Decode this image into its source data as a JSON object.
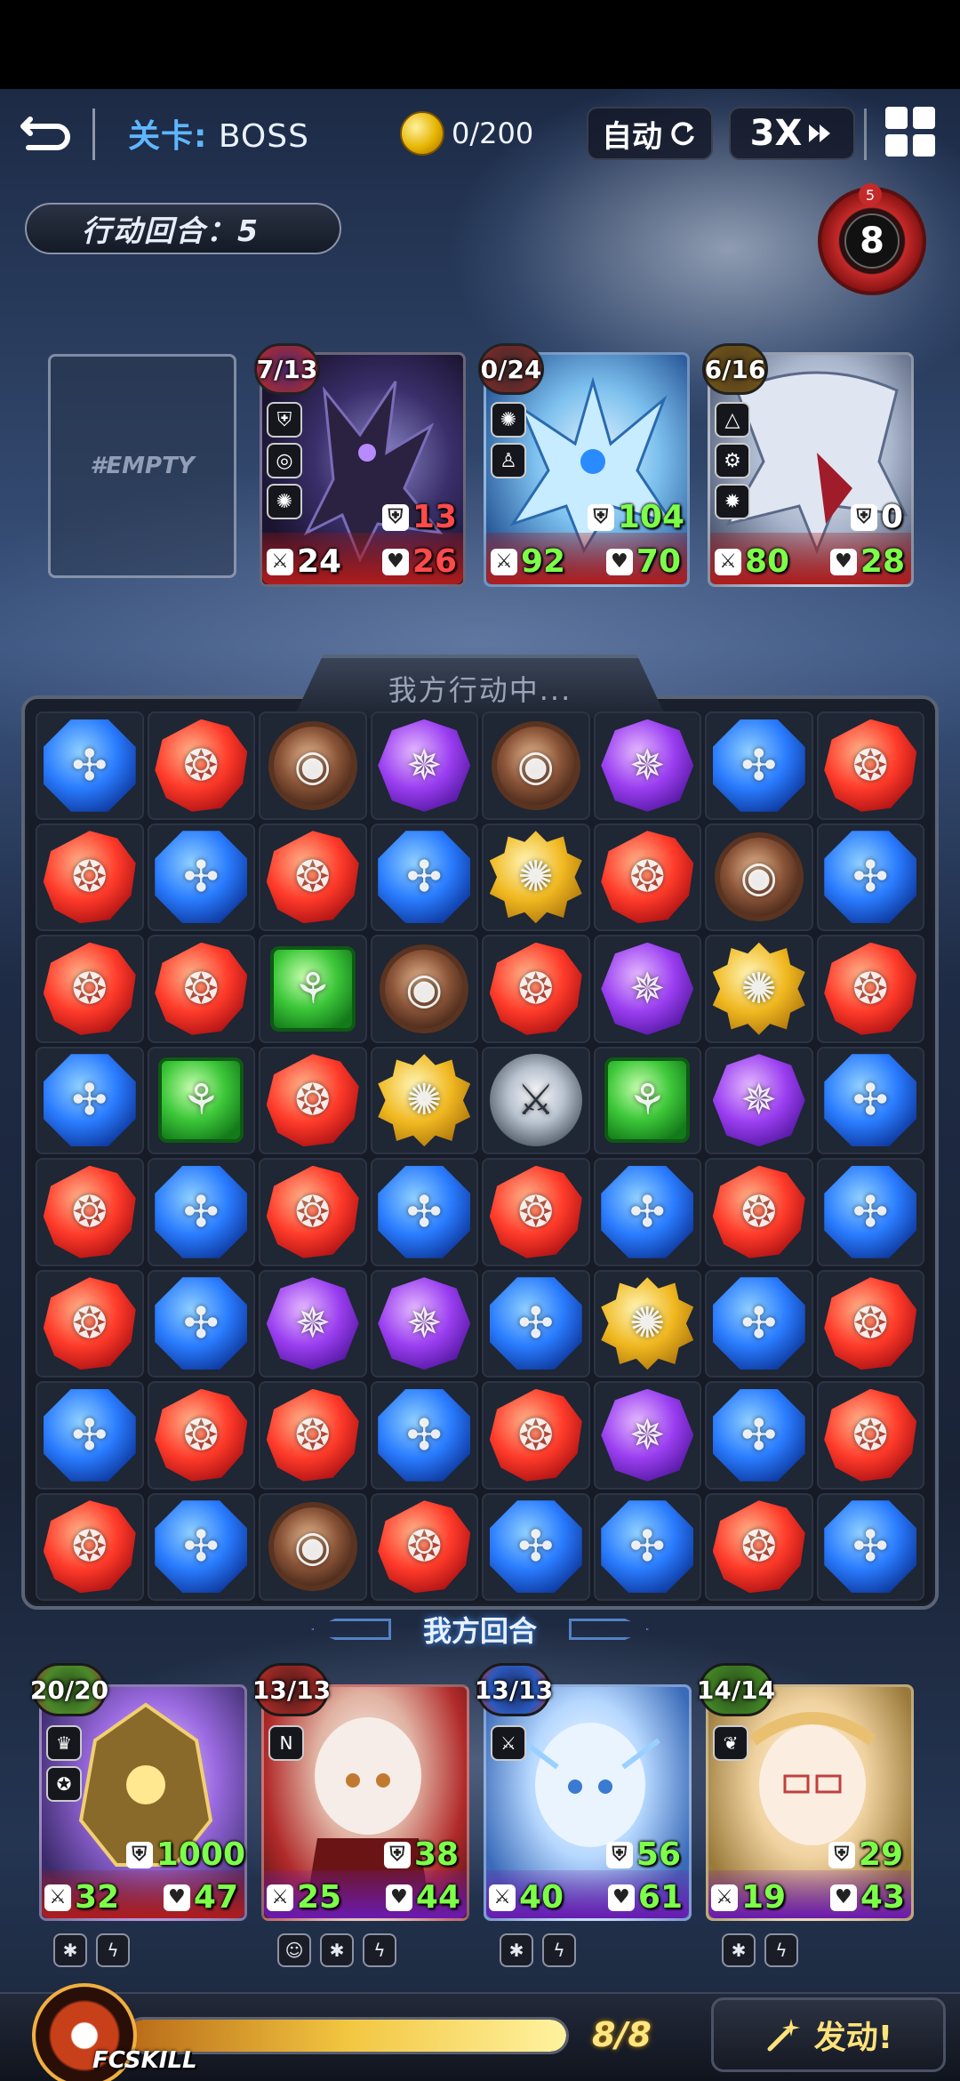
{
  "topbar": {
    "back_icon": "back-arrow-icon",
    "stage_key": "关卡:",
    "stage_value": "BOSS",
    "coin_text": "0/200",
    "auto_label": "自动",
    "speed_label": "3X"
  },
  "turn": {
    "label": "行动回合：5"
  },
  "enemy_timer": {
    "count": "8",
    "tag": "5"
  },
  "enemies": {
    "empty_slot": "#EMPTY",
    "list": [
      {
        "cooldown": "7/13",
        "shield": "13",
        "attack": "24",
        "hp": "26"
      },
      {
        "cooldown": "0/24",
        "shield": "104",
        "attack": "92",
        "hp": "70"
      },
      {
        "cooldown": "6/16",
        "shield": "0",
        "attack": "80",
        "hp": "28"
      }
    ]
  },
  "board": {
    "header": "我方行动中...",
    "footer": "我方回合",
    "rows": [
      [
        "water",
        "fire",
        "earth",
        "dark",
        "earth",
        "dark",
        "water",
        "fire"
      ],
      [
        "fire",
        "water",
        "fire",
        "water",
        "light",
        "fire",
        "earth",
        "water"
      ],
      [
        "fire",
        "fire",
        "wood",
        "earth",
        "fire",
        "dark",
        "light",
        "fire"
      ],
      [
        "water",
        "wood",
        "fire",
        "light",
        "sword",
        "wood",
        "dark",
        "water"
      ],
      [
        "fire",
        "water",
        "fire",
        "water",
        "fire",
        "water",
        "fire",
        "water"
      ],
      [
        "fire",
        "water",
        "dark",
        "dark",
        "water",
        "light",
        "water",
        "fire"
      ],
      [
        "water",
        "fire",
        "fire",
        "water",
        "fire",
        "dark",
        "water",
        "fire"
      ],
      [
        "fire",
        "water",
        "earth",
        "fire",
        "water",
        "water",
        "fire",
        "water"
      ]
    ]
  },
  "team": [
    {
      "hp": "20/20",
      "shield": "1000",
      "attack": "32",
      "life": "47"
    },
    {
      "hp": "13/13",
      "shield": "38",
      "attack": "25",
      "life": "44"
    },
    {
      "hp": "13/13",
      "shield": "56",
      "attack": "40",
      "life": "61"
    },
    {
      "hp": "14/14",
      "shield": "29",
      "attack": "19",
      "life": "43"
    }
  ],
  "fcskill": {
    "label": "FCSKILL",
    "count": "8/8",
    "progress": 1.0,
    "launch_label": "发动!"
  },
  "colors": {
    "accent_blue": "#5fb6ff",
    "stat_green": "#7dff4a",
    "stat_red": "#ff4a4a",
    "gauge_gold": "#f2c640"
  }
}
